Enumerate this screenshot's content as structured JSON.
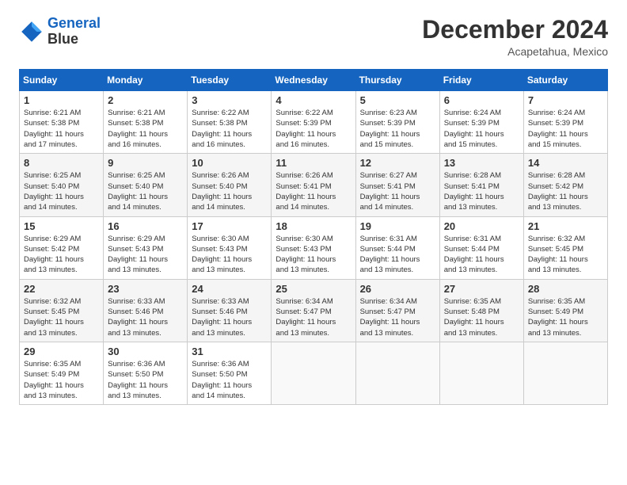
{
  "header": {
    "logo_line1": "General",
    "logo_line2": "Blue",
    "month_title": "December 2024",
    "location": "Acapetahua, Mexico"
  },
  "days_of_week": [
    "Sunday",
    "Monday",
    "Tuesday",
    "Wednesday",
    "Thursday",
    "Friday",
    "Saturday"
  ],
  "weeks": [
    [
      {
        "day": "1",
        "info": "Sunrise: 6:21 AM\nSunset: 5:38 PM\nDaylight: 11 hours\nand 17 minutes."
      },
      {
        "day": "2",
        "info": "Sunrise: 6:21 AM\nSunset: 5:38 PM\nDaylight: 11 hours\nand 16 minutes."
      },
      {
        "day": "3",
        "info": "Sunrise: 6:22 AM\nSunset: 5:38 PM\nDaylight: 11 hours\nand 16 minutes."
      },
      {
        "day": "4",
        "info": "Sunrise: 6:22 AM\nSunset: 5:39 PM\nDaylight: 11 hours\nand 16 minutes."
      },
      {
        "day": "5",
        "info": "Sunrise: 6:23 AM\nSunset: 5:39 PM\nDaylight: 11 hours\nand 15 minutes."
      },
      {
        "day": "6",
        "info": "Sunrise: 6:24 AM\nSunset: 5:39 PM\nDaylight: 11 hours\nand 15 minutes."
      },
      {
        "day": "7",
        "info": "Sunrise: 6:24 AM\nSunset: 5:39 PM\nDaylight: 11 hours\nand 15 minutes."
      }
    ],
    [
      {
        "day": "8",
        "info": "Sunrise: 6:25 AM\nSunset: 5:40 PM\nDaylight: 11 hours\nand 14 minutes."
      },
      {
        "day": "9",
        "info": "Sunrise: 6:25 AM\nSunset: 5:40 PM\nDaylight: 11 hours\nand 14 minutes."
      },
      {
        "day": "10",
        "info": "Sunrise: 6:26 AM\nSunset: 5:40 PM\nDaylight: 11 hours\nand 14 minutes."
      },
      {
        "day": "11",
        "info": "Sunrise: 6:26 AM\nSunset: 5:41 PM\nDaylight: 11 hours\nand 14 minutes."
      },
      {
        "day": "12",
        "info": "Sunrise: 6:27 AM\nSunset: 5:41 PM\nDaylight: 11 hours\nand 14 minutes."
      },
      {
        "day": "13",
        "info": "Sunrise: 6:28 AM\nSunset: 5:41 PM\nDaylight: 11 hours\nand 13 minutes."
      },
      {
        "day": "14",
        "info": "Sunrise: 6:28 AM\nSunset: 5:42 PM\nDaylight: 11 hours\nand 13 minutes."
      }
    ],
    [
      {
        "day": "15",
        "info": "Sunrise: 6:29 AM\nSunset: 5:42 PM\nDaylight: 11 hours\nand 13 minutes."
      },
      {
        "day": "16",
        "info": "Sunrise: 6:29 AM\nSunset: 5:43 PM\nDaylight: 11 hours\nand 13 minutes."
      },
      {
        "day": "17",
        "info": "Sunrise: 6:30 AM\nSunset: 5:43 PM\nDaylight: 11 hours\nand 13 minutes."
      },
      {
        "day": "18",
        "info": "Sunrise: 6:30 AM\nSunset: 5:43 PM\nDaylight: 11 hours\nand 13 minutes."
      },
      {
        "day": "19",
        "info": "Sunrise: 6:31 AM\nSunset: 5:44 PM\nDaylight: 11 hours\nand 13 minutes."
      },
      {
        "day": "20",
        "info": "Sunrise: 6:31 AM\nSunset: 5:44 PM\nDaylight: 11 hours\nand 13 minutes."
      },
      {
        "day": "21",
        "info": "Sunrise: 6:32 AM\nSunset: 5:45 PM\nDaylight: 11 hours\nand 13 minutes."
      }
    ],
    [
      {
        "day": "22",
        "info": "Sunrise: 6:32 AM\nSunset: 5:45 PM\nDaylight: 11 hours\nand 13 minutes."
      },
      {
        "day": "23",
        "info": "Sunrise: 6:33 AM\nSunset: 5:46 PM\nDaylight: 11 hours\nand 13 minutes."
      },
      {
        "day": "24",
        "info": "Sunrise: 6:33 AM\nSunset: 5:46 PM\nDaylight: 11 hours\nand 13 minutes."
      },
      {
        "day": "25",
        "info": "Sunrise: 6:34 AM\nSunset: 5:47 PM\nDaylight: 11 hours\nand 13 minutes."
      },
      {
        "day": "26",
        "info": "Sunrise: 6:34 AM\nSunset: 5:47 PM\nDaylight: 11 hours\nand 13 minutes."
      },
      {
        "day": "27",
        "info": "Sunrise: 6:35 AM\nSunset: 5:48 PM\nDaylight: 11 hours\nand 13 minutes."
      },
      {
        "day": "28",
        "info": "Sunrise: 6:35 AM\nSunset: 5:49 PM\nDaylight: 11 hours\nand 13 minutes."
      }
    ],
    [
      {
        "day": "29",
        "info": "Sunrise: 6:35 AM\nSunset: 5:49 PM\nDaylight: 11 hours\nand 13 minutes."
      },
      {
        "day": "30",
        "info": "Sunrise: 6:36 AM\nSunset: 5:50 PM\nDaylight: 11 hours\nand 13 minutes."
      },
      {
        "day": "31",
        "info": "Sunrise: 6:36 AM\nSunset: 5:50 PM\nDaylight: 11 hours\nand 14 minutes."
      },
      {
        "day": "",
        "info": ""
      },
      {
        "day": "",
        "info": ""
      },
      {
        "day": "",
        "info": ""
      },
      {
        "day": "",
        "info": ""
      }
    ]
  ]
}
